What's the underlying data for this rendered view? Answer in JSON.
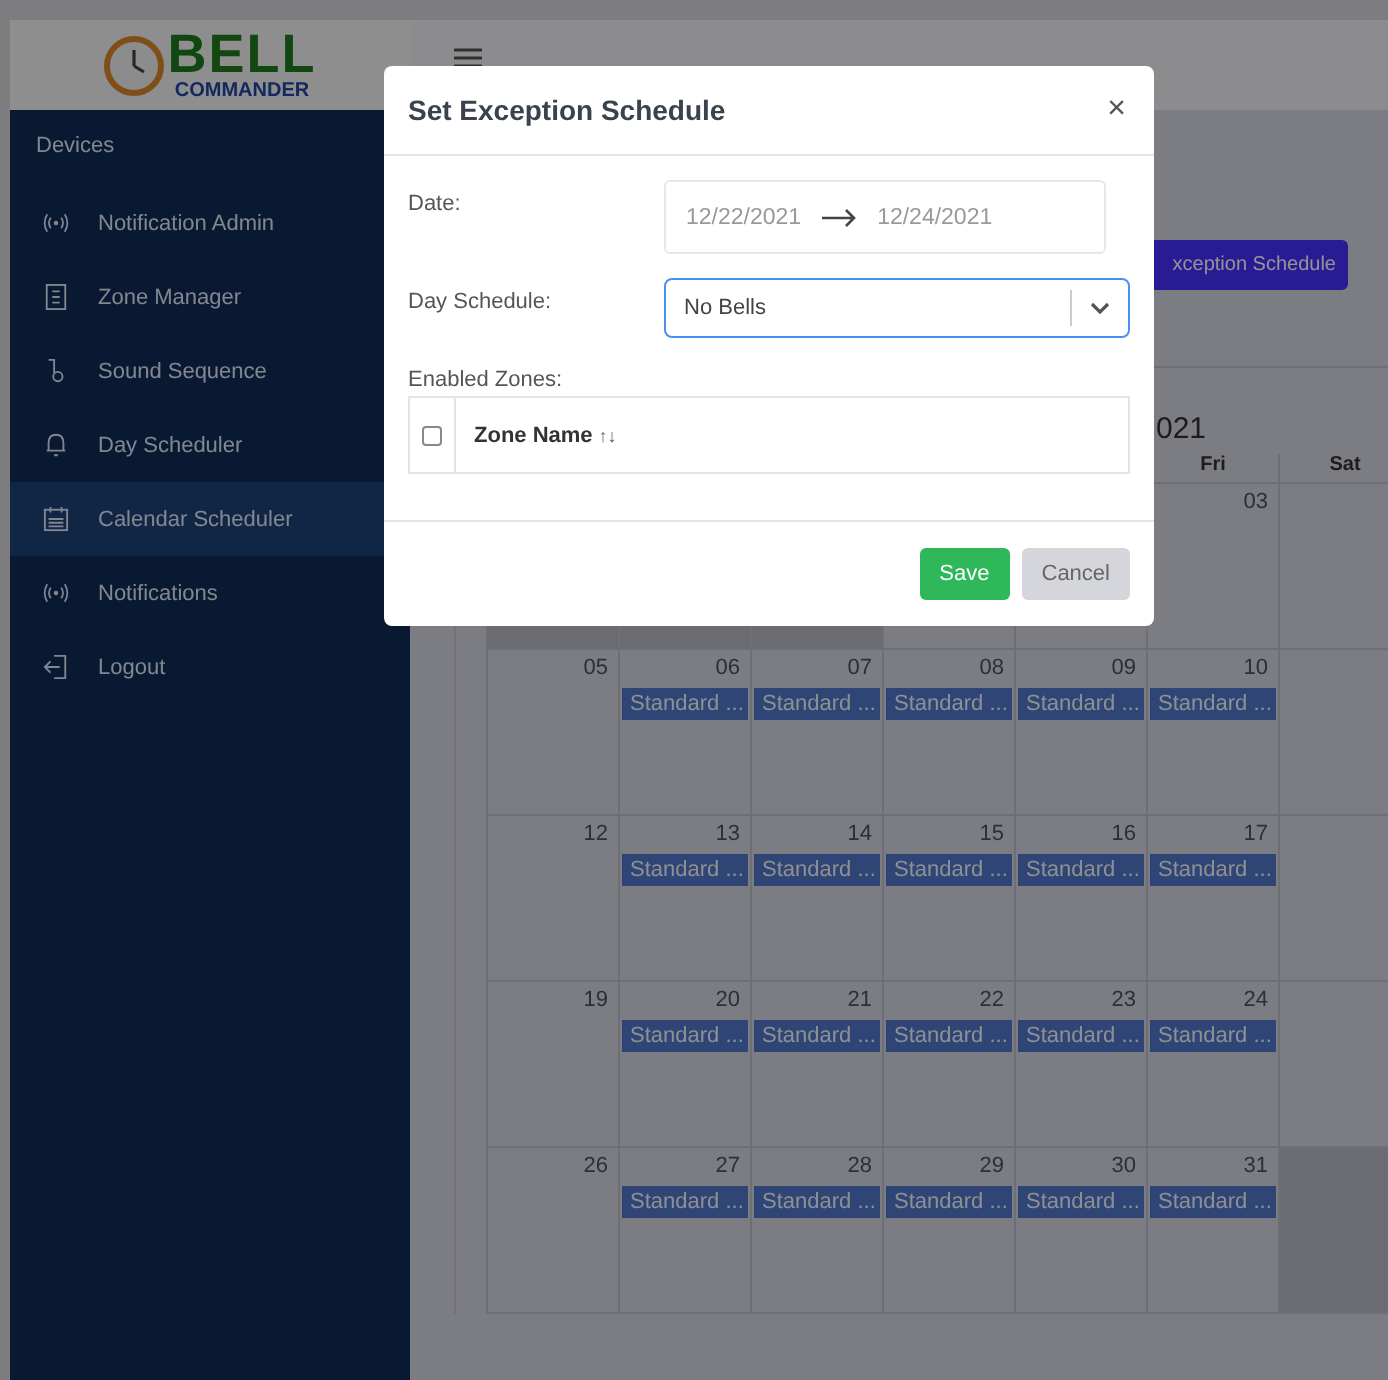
{
  "logo": {
    "title": "BELL",
    "subtitle": "COMMANDER"
  },
  "sidebar": {
    "section": "Devices",
    "items": [
      {
        "label": "Notification Admin",
        "kind": "broadcast",
        "selected": false
      },
      {
        "label": "Zone Manager",
        "kind": "building",
        "selected": false
      },
      {
        "label": "Sound Sequence",
        "kind": "flow",
        "selected": false
      },
      {
        "label": "Day Scheduler",
        "kind": "bell",
        "selected": false
      },
      {
        "label": "Calendar Scheduler",
        "kind": "calendar",
        "selected": true
      },
      {
        "label": "Notifications",
        "kind": "broadcast",
        "selected": false
      },
      {
        "label": "Logout",
        "kind": "logout",
        "selected": false
      }
    ]
  },
  "toolbar": {
    "button": "xception Schedule"
  },
  "calendar": {
    "title": "021",
    "headers": [
      "Fri",
      "Sat"
    ],
    "weeks": [
      [
        {
          "outside": true
        },
        {
          "outside": true
        },
        {
          "outside": true
        },
        {
          "outside": false
        },
        {
          "outside": false
        },
        {
          "day": "03",
          "outside": false
        },
        {
          "outside": false
        }
      ],
      [
        {
          "day": "05",
          "outside": false
        },
        {
          "day": "06",
          "event": "Standard ...",
          "outside": false
        },
        {
          "day": "07",
          "event": "Standard ...",
          "outside": false
        },
        {
          "day": "08",
          "event": "Standard ...",
          "outside": false
        },
        {
          "day": "09",
          "event": "Standard ...",
          "outside": false
        },
        {
          "day": "10",
          "event": "Standard ...",
          "outside": false
        },
        {
          "outside": false
        }
      ],
      [
        {
          "day": "12",
          "outside": false
        },
        {
          "day": "13",
          "event": "Standard ...",
          "outside": false
        },
        {
          "day": "14",
          "event": "Standard ...",
          "outside": false
        },
        {
          "day": "15",
          "event": "Standard ...",
          "outside": false
        },
        {
          "day": "16",
          "event": "Standard ...",
          "outside": false
        },
        {
          "day": "17",
          "event": "Standard ...",
          "outside": false
        },
        {
          "outside": false
        }
      ],
      [
        {
          "day": "19",
          "outside": false
        },
        {
          "day": "20",
          "event": "Standard ...",
          "outside": false
        },
        {
          "day": "21",
          "event": "Standard ...",
          "outside": false
        },
        {
          "day": "22",
          "event": "Standard ...",
          "outside": false
        },
        {
          "day": "23",
          "event": "Standard ...",
          "outside": false
        },
        {
          "day": "24",
          "event": "Standard ...",
          "outside": false
        },
        {
          "outside": false
        }
      ],
      [
        {
          "day": "26",
          "outside": false
        },
        {
          "day": "27",
          "event": "Standard ...",
          "outside": false
        },
        {
          "day": "28",
          "event": "Standard ...",
          "outside": false
        },
        {
          "day": "29",
          "event": "Standard ...",
          "outside": false
        },
        {
          "day": "30",
          "event": "Standard ...",
          "outside": false
        },
        {
          "day": "31",
          "event": "Standard ...",
          "outside": false
        },
        {
          "outside": true
        }
      ]
    ]
  },
  "modal": {
    "title": "Set Exception Schedule",
    "close": "×",
    "date": {
      "label": "Date:",
      "start": "12/22/2021",
      "end": "12/24/2021"
    },
    "day_schedule": {
      "label": "Day Schedule:",
      "value": "No Bells"
    },
    "zones": {
      "label": "Enabled Zones:",
      "column": "Zone Name",
      "sort": "↑↓",
      "checked": false
    },
    "buttons": [
      {
        "label": "Save",
        "kind": "primary"
      },
      {
        "label": "Cancel",
        "kind": "secondary"
      }
    ]
  }
}
